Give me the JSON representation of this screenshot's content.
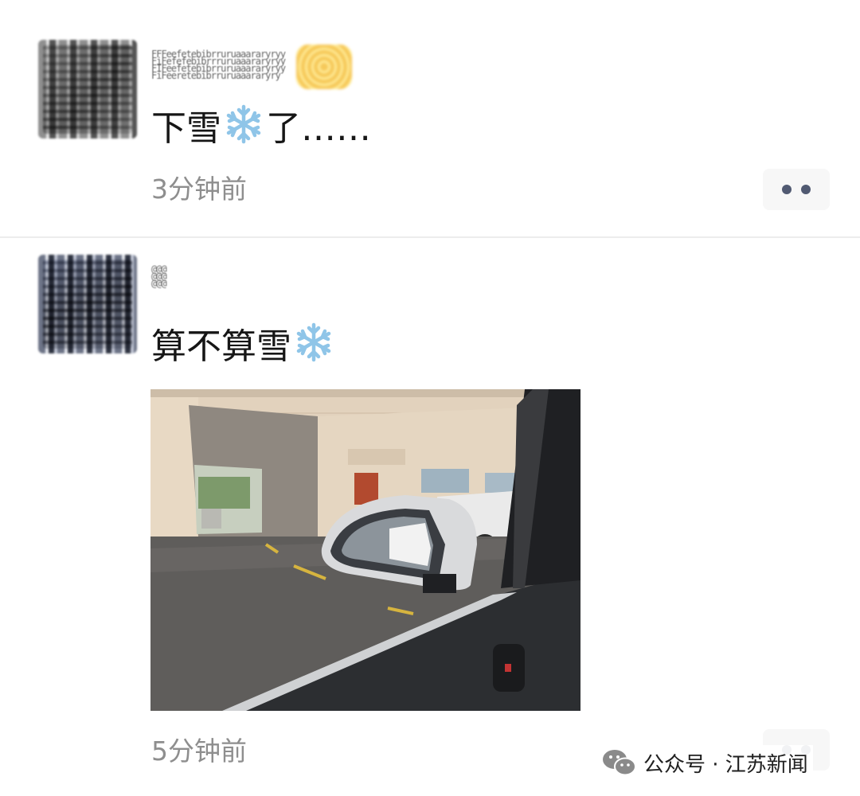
{
  "feed": {
    "posts": [
      {
        "nickname": "FFFeefetebibrruruaaararyryy\nFiFefefebibrrruruaaararyryy\nFIFeefetebibrruruaaararyryy\nFiFeeretebibrruruaaararyry",
        "content_prefix": "下雪",
        "content_suffix": "了……",
        "time": "3分钟前"
      },
      {
        "nickname": "@@@\n@@@\n@@@",
        "content_prefix": "算不算雪",
        "content_suffix": "",
        "time": "5分钟前"
      }
    ]
  },
  "watermark": {
    "text": "公众号 · 江苏新闻"
  },
  "icons": {
    "content_emoji": "snowflake-icon",
    "more": "more-dots-icon",
    "watermark": "wechat-icon"
  },
  "colors": {
    "time_text": "#8e8e8e",
    "more_dots": "#515a72",
    "divider": "#ececec"
  }
}
